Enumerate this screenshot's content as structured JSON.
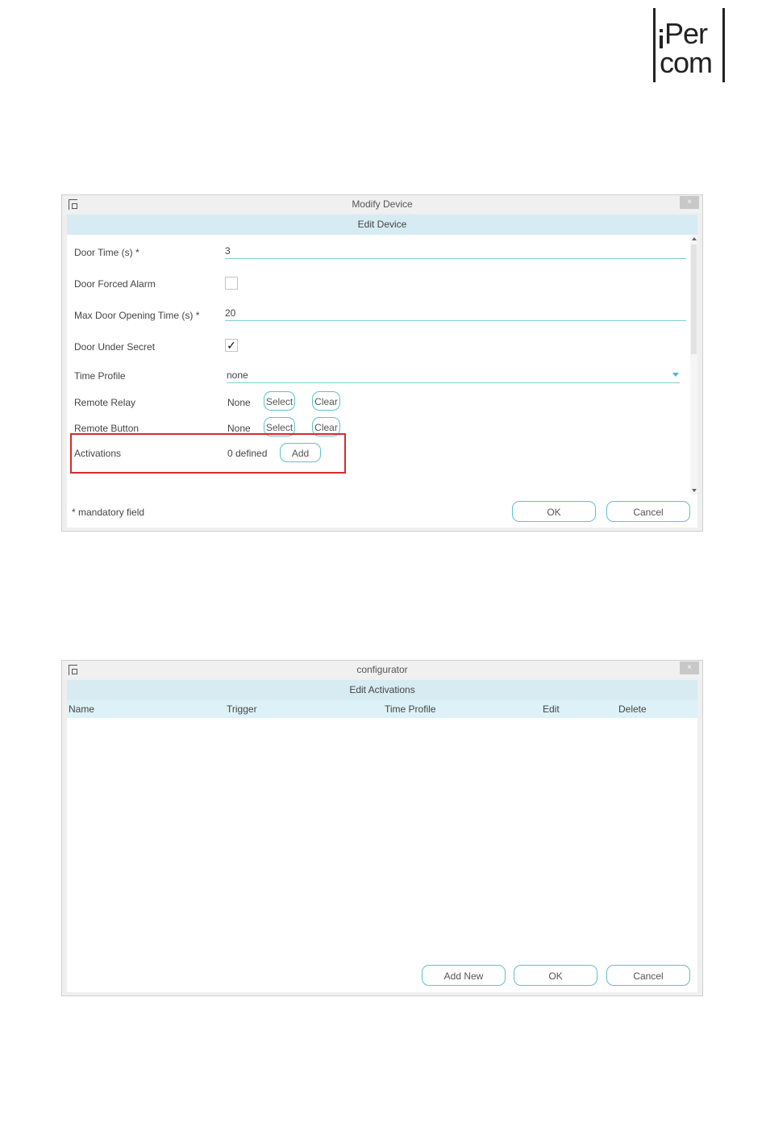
{
  "logo": {
    "line1": "Per",
    "line2": "com"
  },
  "dialog1": {
    "window_title": "Modify Device",
    "close_glyph": "×",
    "section_title": "Edit Device",
    "door_time": {
      "label": "Door Time (s) *",
      "value": "3"
    },
    "door_forced_alarm": {
      "label": "Door Forced Alarm",
      "checked": false
    },
    "max_door_opening": {
      "label": "Max Door Opening Time (s) *",
      "value": "20"
    },
    "door_under_secret": {
      "label": "Door Under Secret",
      "checked": true,
      "check_glyph": "✓"
    },
    "time_profile": {
      "label": "Time Profile",
      "value": "none"
    },
    "remote_relay": {
      "label": "Remote Relay",
      "value": "None",
      "select_label": "Select",
      "clear_label": "Clear"
    },
    "remote_button": {
      "label": "Remote Button",
      "value": "None",
      "select_label": "Select",
      "clear_label": "Clear"
    },
    "activations": {
      "label": "Activations",
      "value": "0 defined",
      "add_label": "Add"
    },
    "mandatory_note": "* mandatory field",
    "ok_label": "OK",
    "cancel_label": "Cancel",
    "highlight_color": "#d62b2b",
    "accent_color": "#5fc2c8"
  },
  "dialog2": {
    "window_title": "configurator",
    "close_glyph": "×",
    "section_title": "Edit Activations",
    "columns": [
      "Name",
      "Trigger",
      "Time Profile",
      "Edit",
      "Delete"
    ],
    "add_new_label": "Add New",
    "ok_label": "OK",
    "cancel_label": "Cancel"
  }
}
